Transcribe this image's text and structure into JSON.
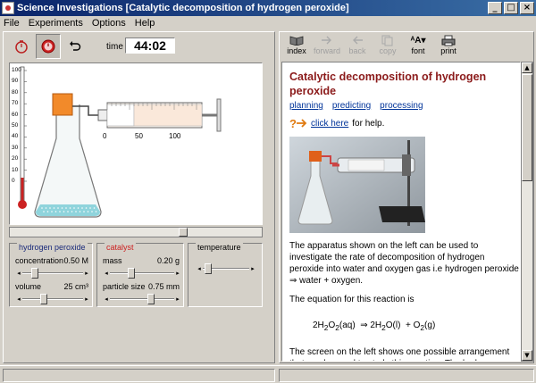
{
  "window": {
    "title": "Science Investigations [Catalytic decomposition of hydrogen peroxide]"
  },
  "menu": [
    "File",
    "Experiments",
    "Options",
    "Help"
  ],
  "toolbar": {
    "time_label": "time",
    "time_value": "44:02"
  },
  "thermometer": {
    "ticks": [
      "100",
      "90",
      "80",
      "70",
      "60",
      "50",
      "40",
      "30",
      "20",
      "10",
      "0"
    ]
  },
  "syringe": {
    "ticks": [
      "0",
      "50",
      "100"
    ]
  },
  "panels": {
    "hydrogen_peroxide": {
      "title": "hydrogen peroxide",
      "concentration_label": "concentration",
      "concentration_value": "0.50 M",
      "volume_label": "volume",
      "volume_value": "25 cm³"
    },
    "catalyst": {
      "title": "catalyst",
      "mass_label": "mass",
      "mass_value": "0.20 g",
      "particle_label": "particle size",
      "particle_value": "0.75 mm"
    },
    "temperature": {
      "title": "temperature"
    }
  },
  "colors": {
    "catalyst_title": "#cc2222",
    "peroxide_title": "#1a2a7a",
    "heading": "#8b1a1a",
    "link": "#003399"
  },
  "right_toolbar": [
    {
      "label": "index",
      "icon": "book-icon",
      "enabled": true
    },
    {
      "label": "forward",
      "icon": "forward-arrow-icon",
      "enabled": false
    },
    {
      "label": "back",
      "icon": "back-arrow-icon",
      "enabled": false
    },
    {
      "label": "copy",
      "icon": "copy-icon",
      "enabled": false
    },
    {
      "label": "font",
      "icon": "font-icon",
      "enabled": true
    },
    {
      "label": "print",
      "icon": "printer-icon",
      "enabled": true
    }
  ],
  "doc": {
    "heading": "Catalytic decomposition of hydrogen peroxide",
    "links": [
      "planning",
      "predicting",
      "processing"
    ],
    "help_link": "click here",
    "help_suffix": "for help.",
    "para1": "The apparatus shown on the left can be used to investigate the rate of decomposition of hydrogen peroxide into water and oxygen gas  i.e hydrogen peroxide  ⇒ water + oxygen.",
    "para2": "The equation for this reaction is",
    "para3": "The screen on the left shows one possible arrangement that can be used to study this reaction. The hydrogen"
  }
}
